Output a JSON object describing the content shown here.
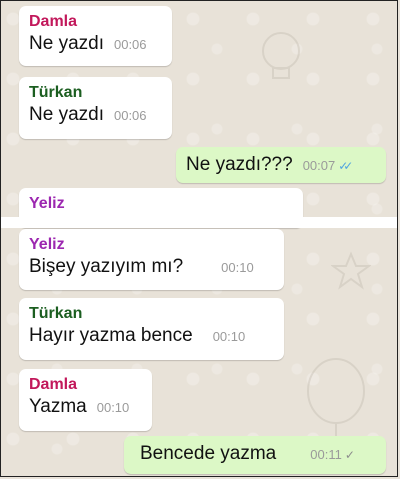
{
  "messages": [
    {
      "sender": "Damla",
      "text": "Ne yazdı",
      "time": "00:06"
    },
    {
      "sender": "Türkan",
      "text": "Ne yazdı",
      "time": "00:06"
    },
    {
      "sender": "",
      "text": "Ne yazdı???",
      "time": "00:07",
      "status": "read"
    },
    {
      "sender": "Yeliz",
      "text": "",
      "time": ""
    },
    {
      "sender": "Yeliz",
      "text": "Bişey yazıyım mı?",
      "time": "00:10"
    },
    {
      "sender": "Türkan",
      "text": "Hayır yazma bence",
      "time": "00:10"
    },
    {
      "sender": "Damla",
      "text": "Yazma",
      "time": "00:10"
    },
    {
      "sender": "",
      "text": "Bencede yazma",
      "time": "00:11",
      "status": "sent"
    }
  ],
  "colors": {
    "damla": "#c2185b",
    "turkan": "#1b5e20",
    "yeliz": "#9c27b0",
    "outgoing_bubble": "#dcf8c6",
    "read_ticks": "#4fa3e0"
  },
  "icons": {
    "read_receipt": "double-check-icon",
    "sent_receipt": "single-check-icon"
  }
}
